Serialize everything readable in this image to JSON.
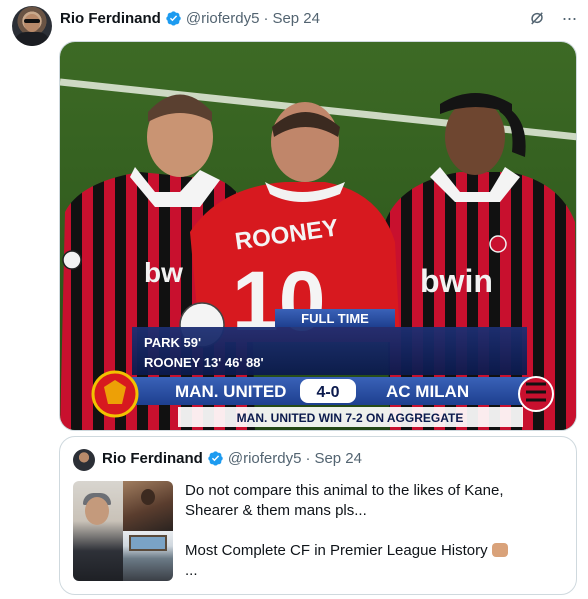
{
  "tweet": {
    "author_name": "Rio Ferdinand",
    "handle": "@rioferdy5",
    "separator": "·",
    "date": "Sep 24",
    "more_label": "···"
  },
  "media": {
    "left_shirt_sponsor": "bw",
    "back_name": "ROONEY",
    "back_number": "10",
    "right_shirt_sponsor": "bwin",
    "status": "FULL TIME",
    "scorer_1": "PARK 59'",
    "scorer_2": "ROONEY 13' 46' 88'",
    "home_team": "MAN. UNITED",
    "score": "4-0",
    "away_team": "AC MILAN",
    "footer": "MAN. UNITED WIN 7-2 ON AGGREGATE"
  },
  "quote": {
    "author_name": "Rio Ferdinand",
    "handle": "@rioferdy5",
    "separator": "·",
    "date": "Sep 24",
    "line1": "Do not compare this animal to the likes of Kane,",
    "line2": "Shearer & them mans pls...",
    "line3": "Most Complete CF in Premier League History",
    "line4": "..."
  },
  "colors": {
    "verified_blue": "#1d9bf0",
    "text_primary": "#0f1419",
    "text_secondary": "#536471",
    "border": "#cfd9de",
    "united_red": "#d7191f",
    "milan_red": "#c8102e",
    "scoreboard_navy": "#10205a"
  },
  "icons": {
    "verified": "verified-badge-icon",
    "grok": "grok-icon",
    "more": "more-options-icon"
  }
}
